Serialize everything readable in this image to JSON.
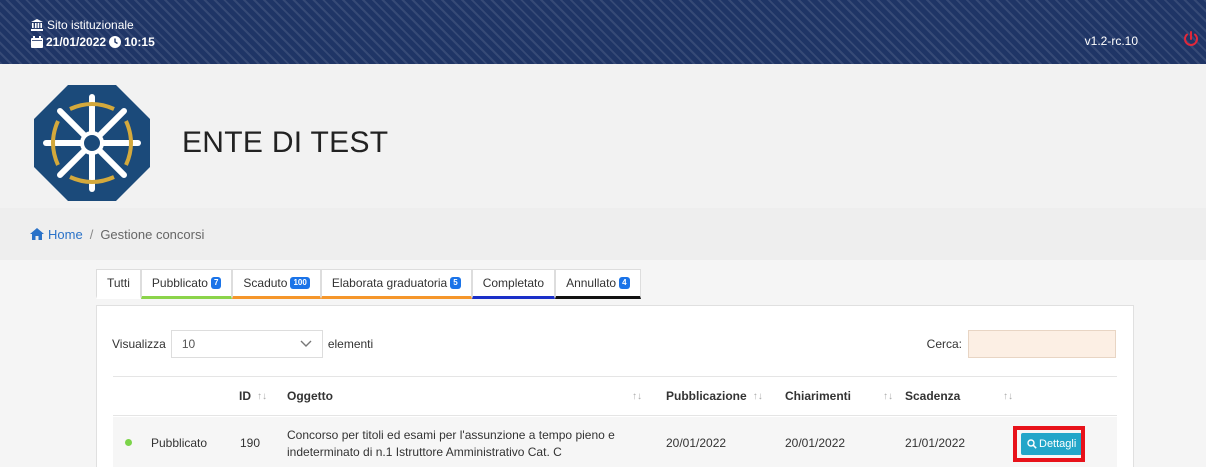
{
  "topbar": {
    "site_label": "Sito istituzionale",
    "date": "21/01/2022",
    "time": "10:15",
    "version": "v1.2-rc.10"
  },
  "header": {
    "ente_name": "ENTE DI TEST"
  },
  "breadcrumb": {
    "home": "Home",
    "separator": "/",
    "current": "Gestione concorsi"
  },
  "tabs": [
    {
      "label": "Tutti",
      "badge": null,
      "color": "#ffffff"
    },
    {
      "label": "Pubblicato",
      "badge": "7",
      "color": "#8bd44a"
    },
    {
      "label": "Scaduto",
      "badge": "100",
      "color": "#f5962a"
    },
    {
      "label": "Elaborata graduatoria",
      "badge": "5",
      "color": "#f5962a"
    },
    {
      "label": "Completato",
      "badge": null,
      "color": "#1a2fc8"
    },
    {
      "label": "Annullato",
      "badge": "4",
      "color": "#111111"
    }
  ],
  "controls": {
    "show_label": "Visualizza",
    "show_value": "10",
    "elements_label": "elementi",
    "search_label": "Cerca:",
    "search_value": ""
  },
  "table": {
    "columns": [
      "ID",
      "Oggetto",
      "Pubblicazione",
      "Chiarimenti",
      "Scadenza"
    ],
    "rows": [
      {
        "status": "Pubblicato",
        "id": "190",
        "oggetto": "Concorso per titoli ed esami per l'assunzione a tempo pieno e indeterminato di n.1 Istruttore Amministrativo Cat. C",
        "pubblicazione": "20/01/2022",
        "chiarimenti": "20/01/2022",
        "scadenza": "21/01/2022",
        "action": "Dettagli"
      }
    ]
  },
  "icons": {
    "site": "bank-icon",
    "date": "calendar-icon",
    "time": "clock-icon",
    "power": "power-icon",
    "home": "home-icon",
    "details": "search-icon"
  },
  "colors": {
    "topbar": "#1f3566",
    "accent": "#23a6c9",
    "highlight": "#e8121a",
    "status_published": "#7cd44a"
  }
}
